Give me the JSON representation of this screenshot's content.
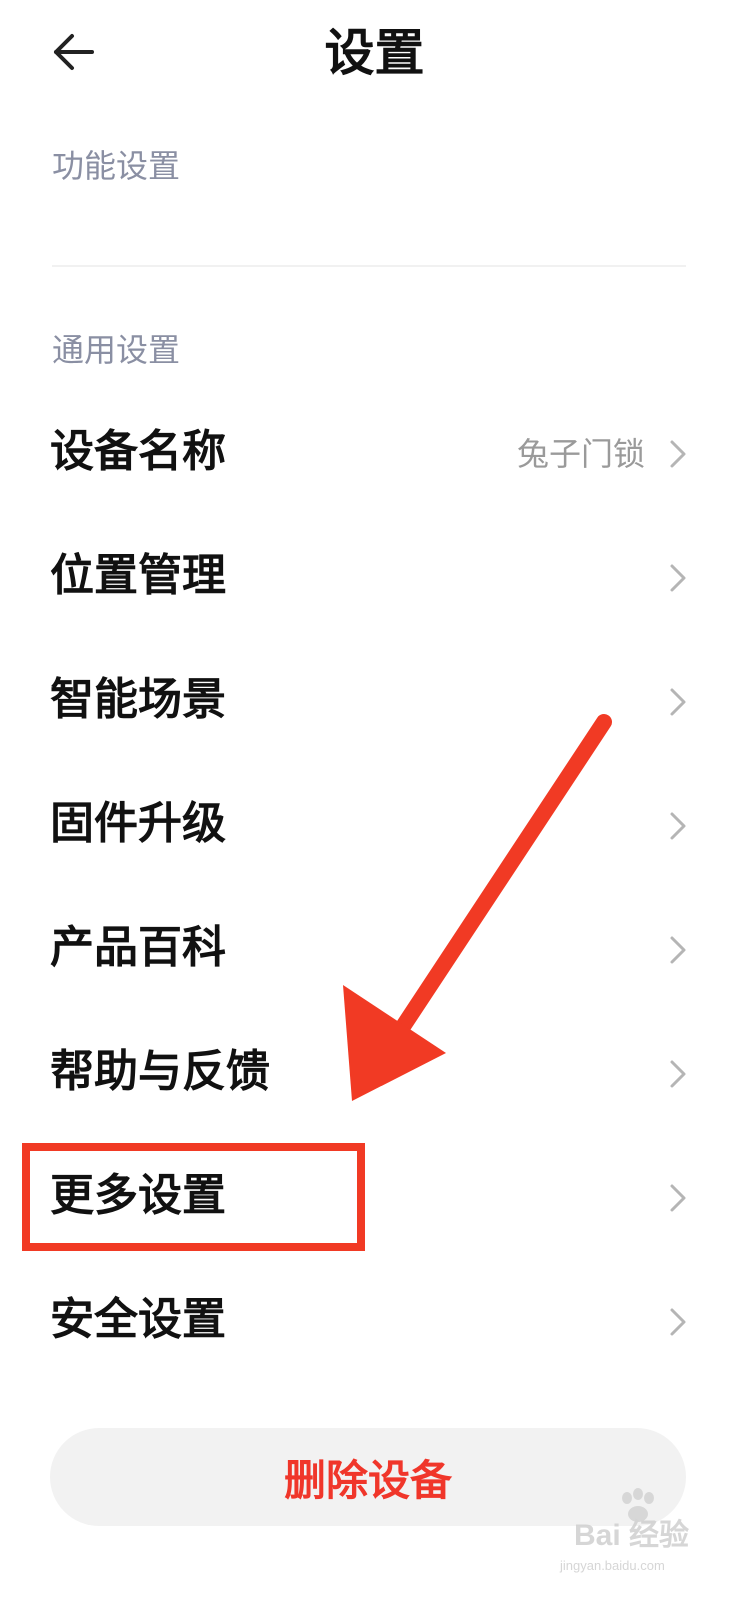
{
  "header": {
    "title": "设置",
    "back_icon": "back-arrow-icon"
  },
  "sections": {
    "functional": {
      "label": "功能设置"
    },
    "general": {
      "label": "通用设置"
    }
  },
  "items": [
    {
      "label": "设备名称",
      "value": "兔子门锁"
    },
    {
      "label": "位置管理"
    },
    {
      "label": "智能场景"
    },
    {
      "label": "固件升级"
    },
    {
      "label": "产品百科"
    },
    {
      "label": "帮助与反馈"
    },
    {
      "label": "更多设置",
      "highlighted": true
    },
    {
      "label": "安全设置"
    }
  ],
  "delete_button": {
    "label": "删除设备"
  },
  "annotation": {
    "color": "#f13a24",
    "shape": "arrow-pointing-to-more-settings"
  },
  "watermark": {
    "brand": "Bai 经验",
    "url": "jingyan.baidu.com"
  },
  "colors": {
    "section_label": "#8a8fa3",
    "delete_text": "#f0362a",
    "annotation": "#f13a24"
  }
}
